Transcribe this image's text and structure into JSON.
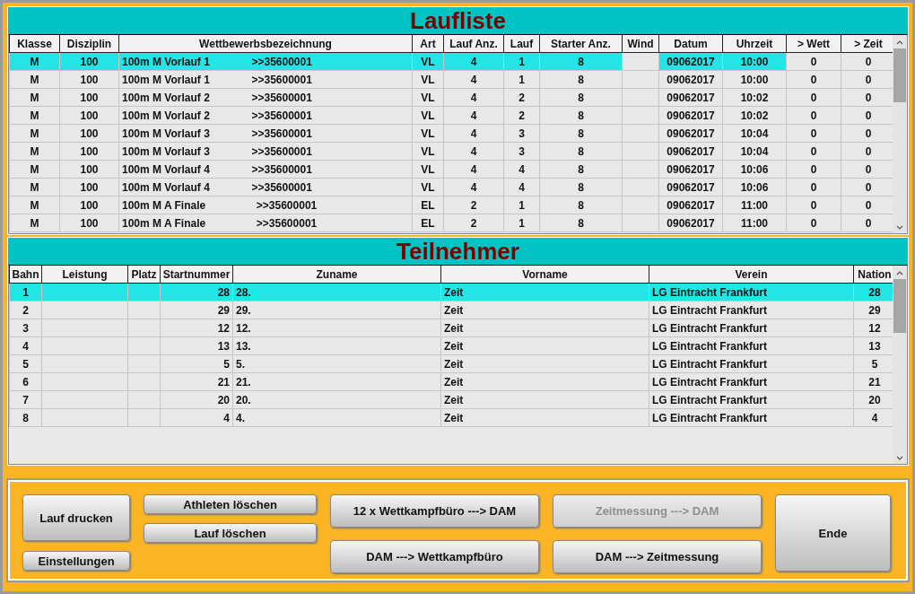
{
  "laufliste": {
    "title": "Laufliste",
    "columns": [
      {
        "label": "Klasse",
        "kind": "data"
      },
      {
        "label": "Disziplin",
        "kind": "data"
      },
      {
        "label": "Wettbewerbsbezeichnung",
        "kind": "text"
      },
      {
        "label": "Art",
        "kind": "data"
      },
      {
        "label": "Lauf Anz.",
        "kind": "data"
      },
      {
        "label": "Lauf",
        "kind": "data"
      },
      {
        "label": "Starter Anz.",
        "kind": "data"
      },
      {
        "label": "Wind",
        "kind": "input"
      },
      {
        "label": "Datum",
        "kind": "data"
      },
      {
        "label": "Uhrzeit",
        "kind": "data"
      },
      {
        "label": "> Wett",
        "kind": "input"
      },
      {
        "label": "> Zeit",
        "kind": "input"
      }
    ],
    "rows": [
      {
        "selected": true,
        "cells": [
          "M",
          "100",
          "100m M Vorlauf 1              >>35600001",
          "VL",
          "4",
          "1",
          "8",
          "",
          "09062017",
          "10:00",
          "0",
          "0"
        ]
      },
      {
        "selected": false,
        "cells": [
          "M",
          "100",
          "100m M Vorlauf 1              >>35600001",
          "VL",
          "4",
          "1",
          "8",
          "",
          "09062017",
          "10:00",
          "0",
          "0"
        ]
      },
      {
        "selected": false,
        "cells": [
          "M",
          "100",
          "100m M Vorlauf 2              >>35600001",
          "VL",
          "4",
          "2",
          "8",
          "",
          "09062017",
          "10:02",
          "0",
          "0"
        ]
      },
      {
        "selected": false,
        "cells": [
          "M",
          "100",
          "100m M Vorlauf 2              >>35600001",
          "VL",
          "4",
          "2",
          "8",
          "",
          "09062017",
          "10:02",
          "0",
          "0"
        ]
      },
      {
        "selected": false,
        "cells": [
          "M",
          "100",
          "100m M Vorlauf 3              >>35600001",
          "VL",
          "4",
          "3",
          "8",
          "",
          "09062017",
          "10:04",
          "0",
          "0"
        ]
      },
      {
        "selected": false,
        "cells": [
          "M",
          "100",
          "100m M Vorlauf 3              >>35600001",
          "VL",
          "4",
          "3",
          "8",
          "",
          "09062017",
          "10:04",
          "0",
          "0"
        ]
      },
      {
        "selected": false,
        "cells": [
          "M",
          "100",
          "100m M Vorlauf 4              >>35600001",
          "VL",
          "4",
          "4",
          "8",
          "",
          "09062017",
          "10:06",
          "0",
          "0"
        ]
      },
      {
        "selected": false,
        "cells": [
          "M",
          "100",
          "100m M Vorlauf 4              >>35600001",
          "VL",
          "4",
          "4",
          "8",
          "",
          "09062017",
          "10:06",
          "0",
          "0"
        ]
      },
      {
        "selected": false,
        "cells": [
          "M",
          "100",
          "100m M A Finale                 >>35600001",
          "EL",
          "2",
          "1",
          "8",
          "",
          "09062017",
          "11:00",
          "0",
          "0"
        ]
      },
      {
        "selected": false,
        "cells": [
          "M",
          "100",
          "100m M A Finale                 >>35600001",
          "EL",
          "2",
          "1",
          "8",
          "",
          "09062017",
          "11:00",
          "0",
          "0"
        ]
      }
    ]
  },
  "teilnehmer": {
    "title": "Teilnehmer",
    "columns": [
      {
        "label": "Bahn",
        "kind": "data"
      },
      {
        "label": "Leistung",
        "kind": "data"
      },
      {
        "label": "Platz",
        "kind": "data"
      },
      {
        "label": "Startnummer",
        "kind": "number"
      },
      {
        "label": "Zuname",
        "kind": "text"
      },
      {
        "label": "Vorname",
        "kind": "text"
      },
      {
        "label": "Verein",
        "kind": "text"
      },
      {
        "label": "Nation",
        "kind": "data"
      }
    ],
    "rows": [
      {
        "selected": true,
        "cells": [
          "1",
          "",
          "",
          "28",
          "28.",
          "Zeit",
          "LG Eintracht Frankfurt",
          "28"
        ]
      },
      {
        "selected": false,
        "cells": [
          "2",
          "",
          "",
          "29",
          "29.",
          "Zeit",
          "LG Eintracht Frankfurt",
          "29"
        ]
      },
      {
        "selected": false,
        "cells": [
          "3",
          "",
          "",
          "12",
          "12.",
          "Zeit",
          "LG Eintracht Frankfurt",
          "12"
        ]
      },
      {
        "selected": false,
        "cells": [
          "4",
          "",
          "",
          "13",
          "13.",
          "Zeit",
          "LG Eintracht Frankfurt",
          "13"
        ]
      },
      {
        "selected": false,
        "cells": [
          "5",
          "",
          "",
          "5",
          "5.",
          "Zeit",
          "LG Eintracht Frankfurt",
          "5"
        ]
      },
      {
        "selected": false,
        "cells": [
          "6",
          "",
          "",
          "21",
          "21.",
          "Zeit",
          "LG Eintracht Frankfurt",
          "21"
        ]
      },
      {
        "selected": false,
        "cells": [
          "7",
          "",
          "",
          "20",
          "20.",
          "Zeit",
          "LG Eintracht Frankfurt",
          "20"
        ]
      },
      {
        "selected": false,
        "cells": [
          "8",
          "",
          "",
          "4",
          "4.",
          "Zeit",
          "LG Eintracht Frankfurt",
          "4"
        ]
      }
    ]
  },
  "button_columns": [
    {
      "kind": "mixed",
      "buttons": [
        {
          "label": "Lauf drucken",
          "disabled": false
        },
        {
          "label": "Einstellungen",
          "disabled": false
        }
      ]
    },
    {
      "kind": "small",
      "buttons": [
        {
          "label": "Athleten löschen",
          "disabled": false
        },
        {
          "label": "Lauf löschen",
          "disabled": false
        }
      ]
    },
    {
      "kind": "wide",
      "buttons": [
        {
          "label": "12 x Wettkampfbüro ---> DAM",
          "disabled": false
        },
        {
          "label": "DAM ---> Wettkampfbüro",
          "disabled": false
        }
      ]
    },
    {
      "kind": "wide",
      "buttons": [
        {
          "label": "Zeitmessung ---> DAM",
          "disabled": true
        },
        {
          "label": "DAM ---> Zeitmessung",
          "disabled": false
        }
      ]
    },
    {
      "kind": "tall",
      "buttons": [
        {
          "label": "Ende",
          "disabled": false
        }
      ]
    }
  ]
}
